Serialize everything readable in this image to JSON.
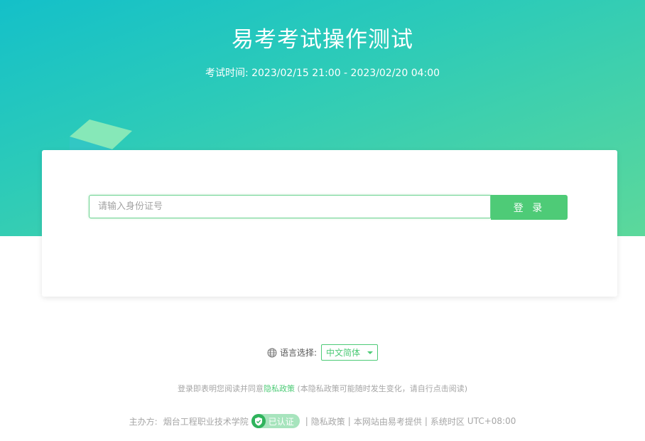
{
  "header": {
    "title": "易考考试操作测试",
    "exam_time": "考试时间: 2023/02/15 21:00 - 2023/02/20 04:00"
  },
  "login": {
    "id_placeholder": "请输入身份证号",
    "id_value": "",
    "button_label": "登 录"
  },
  "language": {
    "label": "语言选择:",
    "selected": "中文简体"
  },
  "privacy_note": {
    "prefix": "登录即表明您阅读并同意",
    "link": "隐私政策",
    "suffix": " (本隐私政策可能随时发生变化，请自行点击阅读)"
  },
  "footer": {
    "organizer_label": "主办方:",
    "organizer_name": "烟台工程职业技术学院",
    "verified_badge": "已认证",
    "privacy_link": "隐私政策",
    "provider_text": "本网站由易考提供",
    "timezone_label": "系统时区",
    "timezone_value": "UTC+08:00",
    "separator": "|"
  },
  "colors": {
    "accent": "#4ecb77",
    "hero_start": "#14c0c9",
    "hero_end": "#5cd89b",
    "muted_text": "#a6a6a6"
  },
  "icons": [
    "globe-icon",
    "shield-check-icon",
    "chevron-down-icon",
    "cube-decoration"
  ]
}
